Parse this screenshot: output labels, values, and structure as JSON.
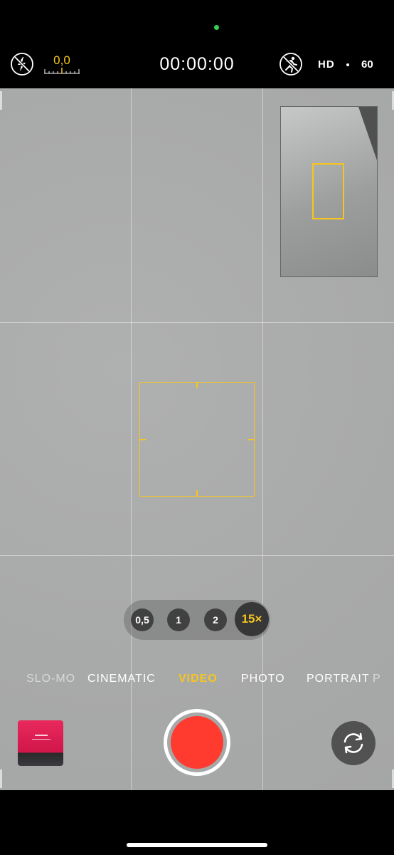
{
  "status": {
    "exposure_value": "0,0",
    "timer": "00:00:00",
    "resolution": "HD",
    "frame_rate": "60"
  },
  "icons": {
    "flash": "flash-off-icon",
    "action_mode": "action-mode-off-icon",
    "flip_camera": "camera-flip-icon"
  },
  "zoom": {
    "options": [
      "0,5",
      "1",
      "2"
    ],
    "active": "15×"
  },
  "modes": {
    "slomo": "SLO-MO",
    "cinematic": "CINEMATIC",
    "video": "VIDEO",
    "photo": "PHOTO",
    "portrait": "PORTRAIT",
    "pano_partial": "P"
  },
  "colors": {
    "accent": "#f6c61e",
    "record": "#ff3b30",
    "indicator": "#30d158"
  }
}
